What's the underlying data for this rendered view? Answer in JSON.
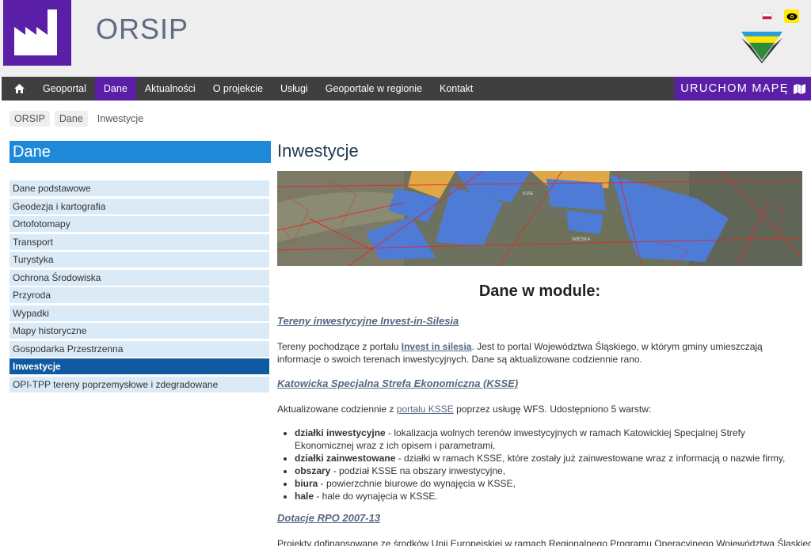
{
  "header": {
    "site_title": "ORSIP",
    "language": "pl",
    "accessibility_icon": "eye-icon",
    "logo_icon": "factory-icon",
    "brand_colors": {
      "purple": "#5a1fa6",
      "blue": "#1e88d9",
      "yellow": "#ffea00",
      "green": "#2e8b3a"
    }
  },
  "nav": {
    "home_icon": "home-icon",
    "items": [
      "Geoportal",
      "Dane",
      "Aktualności",
      "O projekcie",
      "Usługi",
      "Geoportale w regionie",
      "Kontakt"
    ],
    "active": "Dane",
    "launch_label": "URUCHOM MAPĘ",
    "launch_icon": "map-icon"
  },
  "breadcrumb": [
    "ORSIP",
    "Dane",
    "Inwestycje"
  ],
  "sidebar": {
    "title": "Dane",
    "items": [
      "Dane podstawowe",
      "Geodezja i kartografia",
      "Ortofotomapy",
      "Transport",
      "Turystyka",
      "Ochrona Środowiska",
      "Przyroda",
      "Wypadki",
      "Mapy historyczne",
      "Gospodarka Przestrzenna",
      "Inwestycje",
      "OPI-TPP tereny poprzemysłowe i zdegradowane"
    ],
    "active": "Inwestycje"
  },
  "main": {
    "title": "Inwestycje",
    "module_heading": "Dane w module:",
    "section1": {
      "heading": "Tereny inwestycyjne Invest-in-Silesia",
      "text_before": "Tereny pochodzące z portalu ",
      "link": "Invest in silesia",
      "text_after": ". Jest to portal Województwa Śląskiego, w którym gminy umieszczają informacje o swoich terenach inwestycyjnych. Dane są aktualizowane codziennie rano."
    },
    "section2": {
      "heading": "Katowicka Specjalna Strefa Ekonomiczna (KSSE)",
      "text_before": "Aktualizowane codziennie z ",
      "link": "portalu KSSE",
      "text_after": " poprzez usługę WFS. Udostępniono 5 warstw:",
      "bullets": [
        {
          "term": "działki inwestycyjne",
          "desc": " - lokalizacja wolnych terenów inwestycyjnych w ramach Katowickiej Specjalnej Strefy Ekonomicznej wraz z ich opisem i parametrami,"
        },
        {
          "term": "działki zainwestowane",
          "desc": " - działki w ramach KSSE, które zostały już zainwestowane wraz z informacją o nazwie firmy,"
        },
        {
          "term": "obszary",
          "desc": " - podział KSSE na obszary inwestycyjne,"
        },
        {
          "term": "biura",
          "desc": " - powierzchnie biurowe do wynajęcia w KSSE,"
        },
        {
          "term": "hale",
          "desc": " - hale do wynajęcia w KSSE."
        }
      ]
    },
    "section3": {
      "heading": "Dotacje RPO 2007-13",
      "text": "Projekty dofinansowane ze środków Unii Europejskiej w ramach Regionalnego Programu Operacyjnego Województwa Śląskiego na"
    }
  }
}
